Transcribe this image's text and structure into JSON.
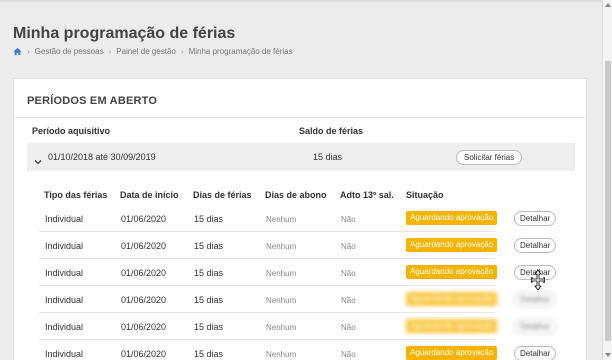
{
  "page": {
    "title": "Minha programação de férias",
    "breadcrumb": [
      "Gestão de pessoas",
      "Painel de gestão",
      "Minha programação de férias"
    ]
  },
  "card": {
    "title": "PERÍODOS EM ABERTO",
    "columns": {
      "period": "Período aquisitivo",
      "balance": "Saldo de férias"
    },
    "period": {
      "range": "01/10/2018 até 30/09/2019",
      "balance": "15 dias",
      "request_label": "Solicitar férias"
    },
    "sub_columns": [
      "Tipo das férias",
      "Data de início",
      "Dias de férias",
      "Dias de abono",
      "Adto 13º sal.",
      "Situação"
    ],
    "rows": [
      {
        "type": "Individual",
        "start": "01/06/2020",
        "days": "15 dias",
        "abono": "Nenhum",
        "adto": "Não",
        "status": "Aguardando aprovação",
        "action": "Detalhar"
      },
      {
        "type": "Individual",
        "start": "01/06/2020",
        "days": "15 dias",
        "abono": "Nenhum",
        "adto": "Não",
        "status": "Aguardando aprovação",
        "action": "Detalhar"
      },
      {
        "type": "Individual",
        "start": "01/06/2020",
        "days": "15 dias",
        "abono": "Nenhum",
        "adto": "Não",
        "status": "Aguardando aprovação",
        "action": "Detalhar"
      },
      {
        "type": "Individual",
        "start": "01/06/2020",
        "days": "15 dias",
        "abono": "Nenhum",
        "adto": "Não",
        "status": "Aguardando aprovação",
        "action": "Detalhar"
      },
      {
        "type": "Individual",
        "start": "01/06/2020",
        "days": "15 dias",
        "abono": "Nenhum",
        "adto": "Não",
        "status": "Aguardando aprovação",
        "action": "Detalhar"
      },
      {
        "type": "Individual",
        "start": "01/06/2020",
        "days": "15 dias",
        "abono": "Nenhum",
        "adto": "Não",
        "status": "Aguardando aprovação",
        "action": "Detalhar"
      }
    ]
  },
  "colors": {
    "status_badge": "#f6b400",
    "link_blue": "#3a7bd5"
  },
  "icons": {
    "home": "home-icon",
    "chevron": "chevron-down-icon",
    "breadcrumb_sep": "chevron-right-icon"
  }
}
